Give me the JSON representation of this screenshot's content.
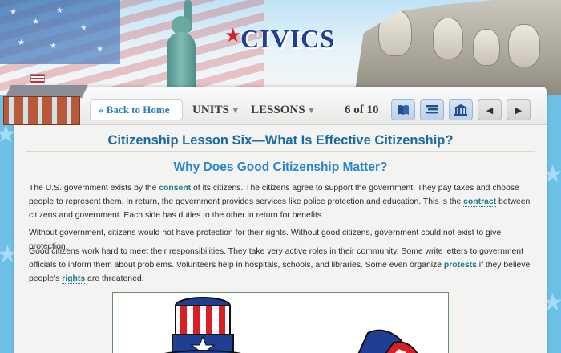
{
  "header": {
    "logo_text": "CIVICS",
    "accent_red": "#d81f26",
    "logo_blue": "#1f3f95"
  },
  "nav": {
    "back_label": "« Back to Home",
    "units_label": "UNITS",
    "lessons_label": "LESSONS",
    "caret": "▼",
    "page_indicator": "6 of 10",
    "icons": [
      "book-icon",
      "list-icon",
      "capitol-building-icon",
      "prev-arrow-icon",
      "next-arrow-icon"
    ],
    "prev_glyph": "◀",
    "next_glyph": "▶"
  },
  "content": {
    "lesson_title": "Citizenship Lesson Six—What Is Effective Citizenship?",
    "section_title": "Why Does Good Citizenship Matter?",
    "p1": {
      "a": "The U.S. government exists by the ",
      "k1": "consent",
      "b": " of its citizens. The citizens agree to support the government. They pay taxes and choose people to represent them. In return, the government provides services like police protection and education. This is the ",
      "k2": "contract",
      "c": " between citizens and government. Each side has duties to the other in return for benefits."
    },
    "p2": "Without government, citizens would not have protection for their rights. Without good citizens, government could not exist to give protection.",
    "p3": {
      "a": "Good citizens work hard to meet their responsibilities. They take very active roles in their community. Some write letters to government officials to inform them about problems. Volunteers help in hospitals, schools, and libraries. Some even organize ",
      "k1": "protests",
      "b": " if they believe people's ",
      "k2": "rights",
      "c": " are threatened."
    }
  }
}
